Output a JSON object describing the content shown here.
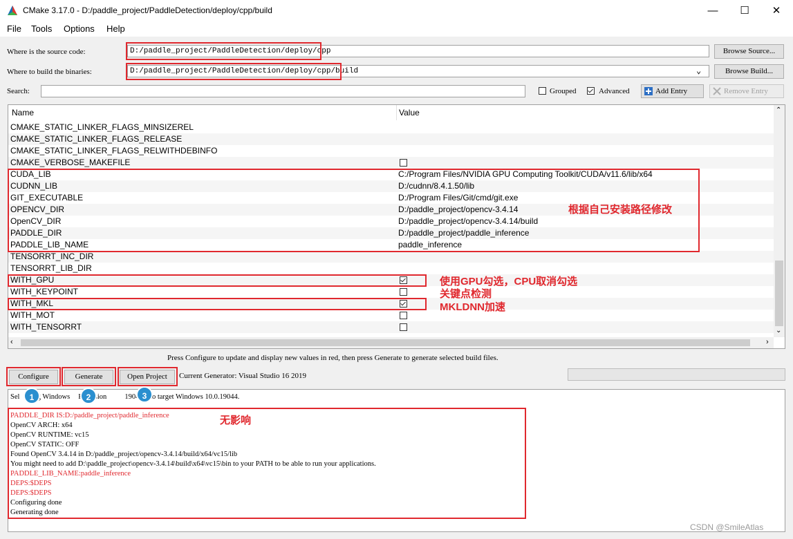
{
  "window": {
    "title": "CMake 3.17.0 - D:/paddle_project/PaddleDetection/deploy/cpp/build"
  },
  "menu": [
    "File",
    "Tools",
    "Options",
    "Help"
  ],
  "source": {
    "label": "Where is the source code:",
    "value": "D:/paddle_project/PaddleDetection/deploy/cpp",
    "browse": "Browse Source..."
  },
  "build": {
    "label": "Where to build the binaries:",
    "value": "D:/paddle_project/PaddleDetection/deploy/cpp/build",
    "browse": "Browse Build..."
  },
  "search": {
    "label": "Search:",
    "value": ""
  },
  "options": {
    "grouped": "Grouped",
    "grouped_checked": false,
    "advanced": "Advanced",
    "advanced_checked": true,
    "add_entry": "Add Entry",
    "remove_entry": "Remove Entry"
  },
  "table": {
    "headers": [
      "Name",
      "Value"
    ],
    "rows": [
      {
        "name": "CMAKE_STATIC_LINKER_FLAGS_MINSIZEREL",
        "value": ""
      },
      {
        "name": "CMAKE_STATIC_LINKER_FLAGS_RELEASE",
        "value": ""
      },
      {
        "name": "CMAKE_STATIC_LINKER_FLAGS_RELWITHDEBINFO",
        "value": ""
      },
      {
        "name": "CMAKE_VERBOSE_MAKEFILE",
        "value": "",
        "checkbox": true,
        "checked": false
      },
      {
        "name": "CUDA_LIB",
        "value": "C:/Program Files/NVIDIA GPU Computing Toolkit/CUDA/v11.6/lib/x64"
      },
      {
        "name": "CUDNN_LIB",
        "value": "D:/cudnn/8.4.1.50/lib"
      },
      {
        "name": "GIT_EXECUTABLE",
        "value": "D:/Program Files/Git/cmd/git.exe"
      },
      {
        "name": "OPENCV_DIR",
        "value": "D:/paddle_project/opencv-3.4.14"
      },
      {
        "name": "OpenCV_DIR",
        "value": "D:/paddle_project/opencv-3.4.14/build"
      },
      {
        "name": "PADDLE_DIR",
        "value": "D:/paddle_project/paddle_inference"
      },
      {
        "name": "PADDLE_LIB_NAME",
        "value": "paddle_inference"
      },
      {
        "name": "TENSORRT_INC_DIR",
        "value": ""
      },
      {
        "name": "TENSORRT_LIB_DIR",
        "value": ""
      },
      {
        "name": "WITH_GPU",
        "value": "",
        "checkbox": true,
        "checked": true
      },
      {
        "name": "WITH_KEYPOINT",
        "value": "",
        "checkbox": true,
        "checked": false
      },
      {
        "name": "WITH_MKL",
        "value": "",
        "checkbox": true,
        "checked": true
      },
      {
        "name": "WITH_MOT",
        "value": "",
        "checkbox": true,
        "checked": false
      },
      {
        "name": "WITH_TENSORRT",
        "value": "",
        "checkbox": true,
        "checked": false
      }
    ]
  },
  "annotations": {
    "paths": "根据自己安装路径修改",
    "gpu": "使用GPU勾选，CPU取消勾选",
    "keypoint": "关键点检测",
    "mkl": "MKLDNN加速",
    "output": "无影响"
  },
  "hint": "Press Configure to update and display new values in red, then press Generate to generate selected build files.",
  "buttons": {
    "configure": "Configure",
    "generate": "Generate",
    "open_project": "Open Project"
  },
  "generator": "Current Generator: Visual Studio 16 2019",
  "badges": [
    "1",
    "2",
    "3"
  ],
  "output": {
    "first_line_start": "Sel",
    "first_line_a": "ng Windows",
    "first_line_b": "K version",
    "first_line_c": "19041.0 to target Windows 10.0.19044.",
    "lines": [
      {
        "text": "PADDLE_DIR IS:D:/paddle_project/paddle_inference",
        "red": true
      },
      {
        "text": "OpenCV ARCH: x64",
        "red": false
      },
      {
        "text": "OpenCV RUNTIME: vc15",
        "red": false
      },
      {
        "text": "OpenCV STATIC: OFF",
        "red": false
      },
      {
        "text": "Found OpenCV 3.4.14 in D:/paddle_project/opencv-3.4.14/build/x64/vc15/lib",
        "red": false
      },
      {
        "text": "You might need to add D:\\paddle_project\\opencv-3.4.14\\build\\x64\\vc15\\bin to your PATH to be able to run your applications.",
        "red": false
      },
      {
        "text": "PADDLE_LIB_NAME:paddle_inference",
        "red": true
      },
      {
        "text": "DEPS:$DEPS",
        "red": true
      },
      {
        "text": "DEPS:$DEPS",
        "red": true
      },
      {
        "text": "Configuring done",
        "red": false
      },
      {
        "text": "Generating done",
        "red": false
      }
    ]
  },
  "watermark": "CSDN @SmileAtlas",
  "colors": {
    "annotation_red": "#e0282e",
    "badge_blue": "#2b8fcf"
  }
}
